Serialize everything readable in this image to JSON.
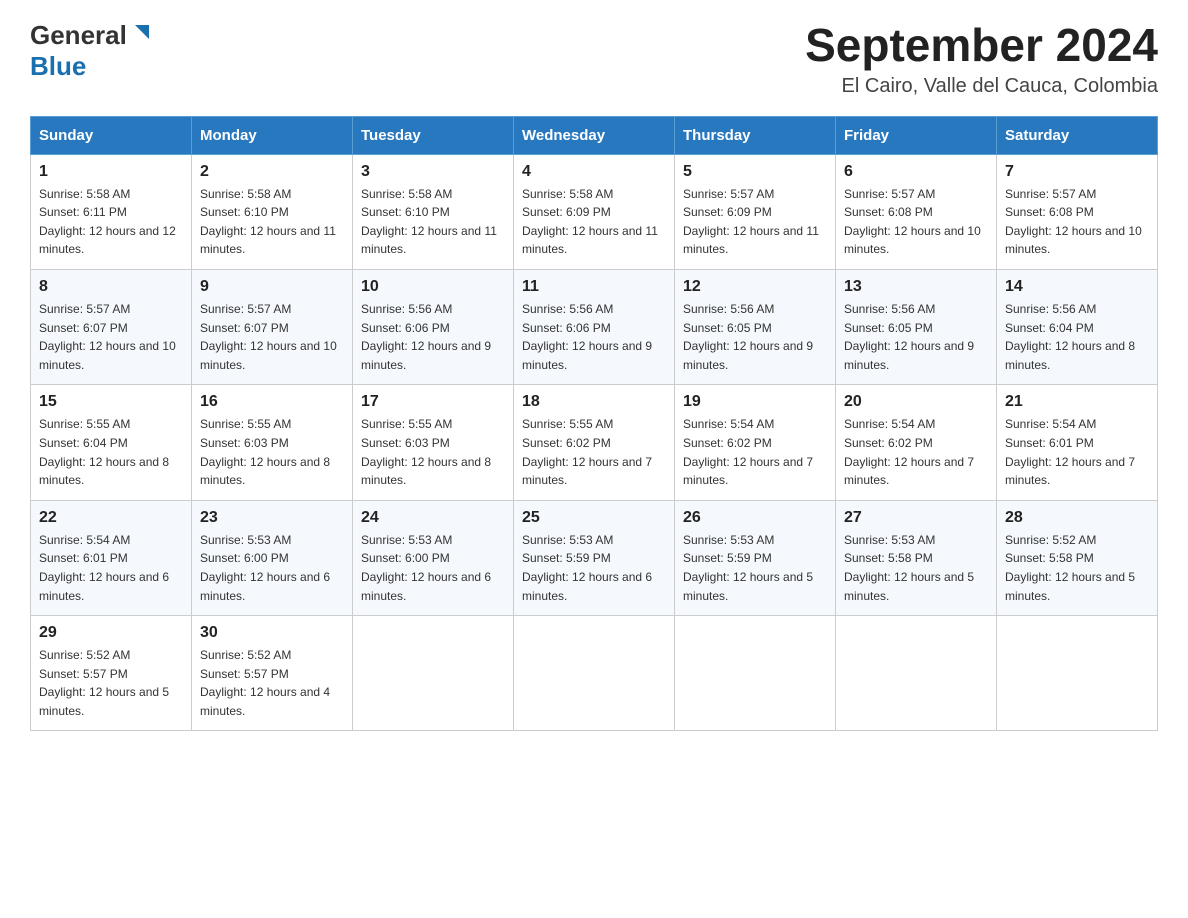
{
  "header": {
    "logo_general": "General",
    "logo_blue": "Blue",
    "title": "September 2024",
    "subtitle": "El Cairo, Valle del Cauca, Colombia"
  },
  "days_of_week": [
    "Sunday",
    "Monday",
    "Tuesday",
    "Wednesday",
    "Thursday",
    "Friday",
    "Saturday"
  ],
  "weeks": [
    [
      {
        "day": "1",
        "sunrise": "Sunrise: 5:58 AM",
        "sunset": "Sunset: 6:11 PM",
        "daylight": "Daylight: 12 hours and 12 minutes."
      },
      {
        "day": "2",
        "sunrise": "Sunrise: 5:58 AM",
        "sunset": "Sunset: 6:10 PM",
        "daylight": "Daylight: 12 hours and 11 minutes."
      },
      {
        "day": "3",
        "sunrise": "Sunrise: 5:58 AM",
        "sunset": "Sunset: 6:10 PM",
        "daylight": "Daylight: 12 hours and 11 minutes."
      },
      {
        "day": "4",
        "sunrise": "Sunrise: 5:58 AM",
        "sunset": "Sunset: 6:09 PM",
        "daylight": "Daylight: 12 hours and 11 minutes."
      },
      {
        "day": "5",
        "sunrise": "Sunrise: 5:57 AM",
        "sunset": "Sunset: 6:09 PM",
        "daylight": "Daylight: 12 hours and 11 minutes."
      },
      {
        "day": "6",
        "sunrise": "Sunrise: 5:57 AM",
        "sunset": "Sunset: 6:08 PM",
        "daylight": "Daylight: 12 hours and 10 minutes."
      },
      {
        "day": "7",
        "sunrise": "Sunrise: 5:57 AM",
        "sunset": "Sunset: 6:08 PM",
        "daylight": "Daylight: 12 hours and 10 minutes."
      }
    ],
    [
      {
        "day": "8",
        "sunrise": "Sunrise: 5:57 AM",
        "sunset": "Sunset: 6:07 PM",
        "daylight": "Daylight: 12 hours and 10 minutes."
      },
      {
        "day": "9",
        "sunrise": "Sunrise: 5:57 AM",
        "sunset": "Sunset: 6:07 PM",
        "daylight": "Daylight: 12 hours and 10 minutes."
      },
      {
        "day": "10",
        "sunrise": "Sunrise: 5:56 AM",
        "sunset": "Sunset: 6:06 PM",
        "daylight": "Daylight: 12 hours and 9 minutes."
      },
      {
        "day": "11",
        "sunrise": "Sunrise: 5:56 AM",
        "sunset": "Sunset: 6:06 PM",
        "daylight": "Daylight: 12 hours and 9 minutes."
      },
      {
        "day": "12",
        "sunrise": "Sunrise: 5:56 AM",
        "sunset": "Sunset: 6:05 PM",
        "daylight": "Daylight: 12 hours and 9 minutes."
      },
      {
        "day": "13",
        "sunrise": "Sunrise: 5:56 AM",
        "sunset": "Sunset: 6:05 PM",
        "daylight": "Daylight: 12 hours and 9 minutes."
      },
      {
        "day": "14",
        "sunrise": "Sunrise: 5:56 AM",
        "sunset": "Sunset: 6:04 PM",
        "daylight": "Daylight: 12 hours and 8 minutes."
      }
    ],
    [
      {
        "day": "15",
        "sunrise": "Sunrise: 5:55 AM",
        "sunset": "Sunset: 6:04 PM",
        "daylight": "Daylight: 12 hours and 8 minutes."
      },
      {
        "day": "16",
        "sunrise": "Sunrise: 5:55 AM",
        "sunset": "Sunset: 6:03 PM",
        "daylight": "Daylight: 12 hours and 8 minutes."
      },
      {
        "day": "17",
        "sunrise": "Sunrise: 5:55 AM",
        "sunset": "Sunset: 6:03 PM",
        "daylight": "Daylight: 12 hours and 8 minutes."
      },
      {
        "day": "18",
        "sunrise": "Sunrise: 5:55 AM",
        "sunset": "Sunset: 6:02 PM",
        "daylight": "Daylight: 12 hours and 7 minutes."
      },
      {
        "day": "19",
        "sunrise": "Sunrise: 5:54 AM",
        "sunset": "Sunset: 6:02 PM",
        "daylight": "Daylight: 12 hours and 7 minutes."
      },
      {
        "day": "20",
        "sunrise": "Sunrise: 5:54 AM",
        "sunset": "Sunset: 6:02 PM",
        "daylight": "Daylight: 12 hours and 7 minutes."
      },
      {
        "day": "21",
        "sunrise": "Sunrise: 5:54 AM",
        "sunset": "Sunset: 6:01 PM",
        "daylight": "Daylight: 12 hours and 7 minutes."
      }
    ],
    [
      {
        "day": "22",
        "sunrise": "Sunrise: 5:54 AM",
        "sunset": "Sunset: 6:01 PM",
        "daylight": "Daylight: 12 hours and 6 minutes."
      },
      {
        "day": "23",
        "sunrise": "Sunrise: 5:53 AM",
        "sunset": "Sunset: 6:00 PM",
        "daylight": "Daylight: 12 hours and 6 minutes."
      },
      {
        "day": "24",
        "sunrise": "Sunrise: 5:53 AM",
        "sunset": "Sunset: 6:00 PM",
        "daylight": "Daylight: 12 hours and 6 minutes."
      },
      {
        "day": "25",
        "sunrise": "Sunrise: 5:53 AM",
        "sunset": "Sunset: 5:59 PM",
        "daylight": "Daylight: 12 hours and 6 minutes."
      },
      {
        "day": "26",
        "sunrise": "Sunrise: 5:53 AM",
        "sunset": "Sunset: 5:59 PM",
        "daylight": "Daylight: 12 hours and 5 minutes."
      },
      {
        "day": "27",
        "sunrise": "Sunrise: 5:53 AM",
        "sunset": "Sunset: 5:58 PM",
        "daylight": "Daylight: 12 hours and 5 minutes."
      },
      {
        "day": "28",
        "sunrise": "Sunrise: 5:52 AM",
        "sunset": "Sunset: 5:58 PM",
        "daylight": "Daylight: 12 hours and 5 minutes."
      }
    ],
    [
      {
        "day": "29",
        "sunrise": "Sunrise: 5:52 AM",
        "sunset": "Sunset: 5:57 PM",
        "daylight": "Daylight: 12 hours and 5 minutes."
      },
      {
        "day": "30",
        "sunrise": "Sunrise: 5:52 AM",
        "sunset": "Sunset: 5:57 PM",
        "daylight": "Daylight: 12 hours and 4 minutes."
      },
      null,
      null,
      null,
      null,
      null
    ]
  ],
  "colors": {
    "header_bg": "#2878c0",
    "header_text": "#ffffff",
    "border": "#ccc",
    "accent_blue": "#1a6faf"
  }
}
